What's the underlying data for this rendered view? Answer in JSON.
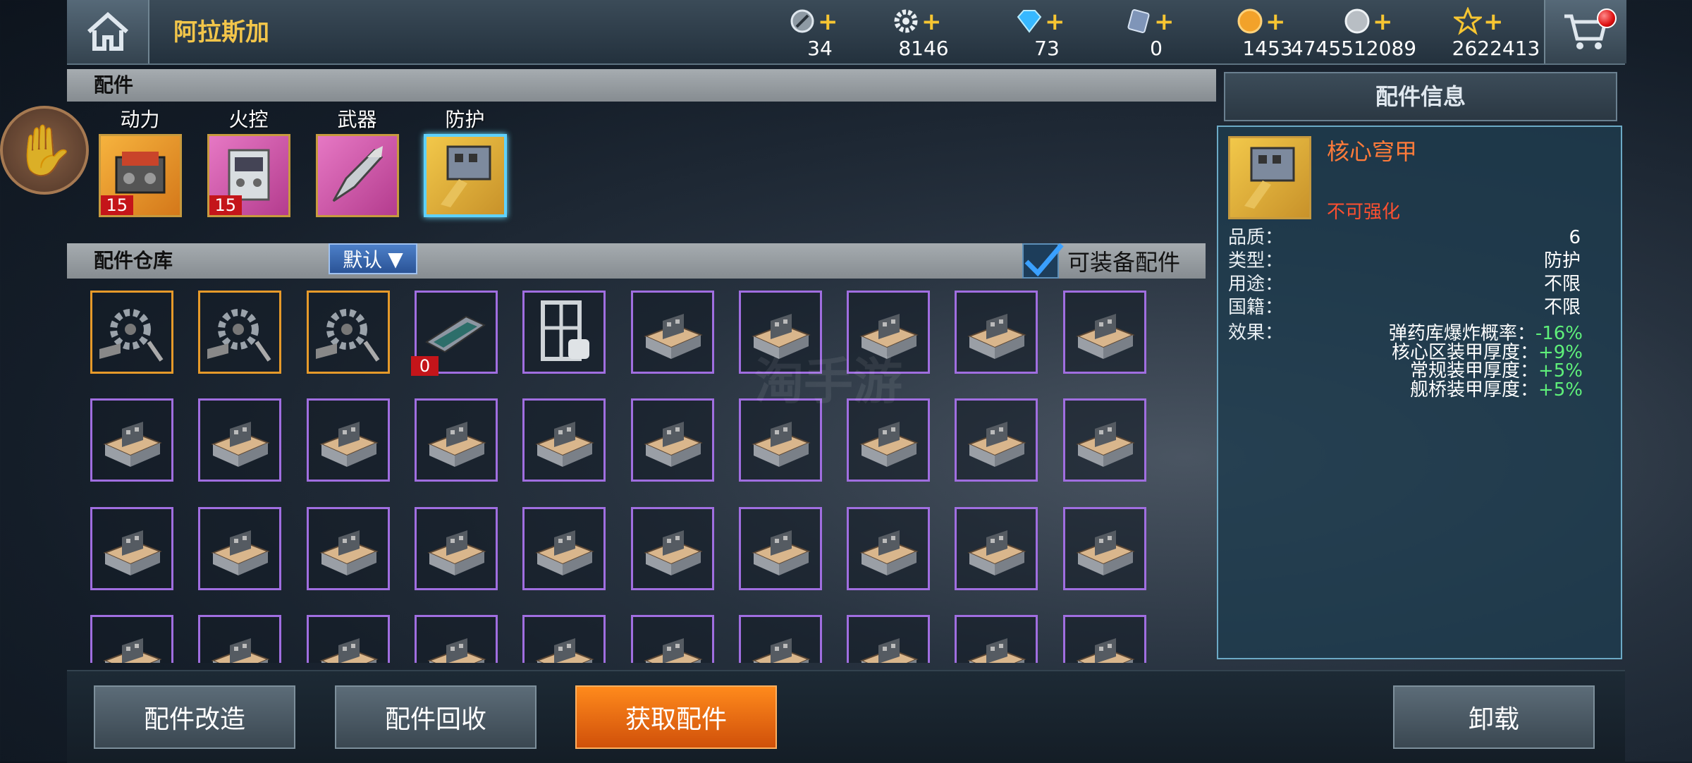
{
  "header": {
    "title": "阿拉斯加",
    "resources": [
      {
        "icon": "fuel-icon",
        "value": "34"
      },
      {
        "icon": "gear-parts-icon",
        "value": "8146"
      },
      {
        "icon": "diamond-icon",
        "value": "73"
      },
      {
        "icon": "ticket-icon",
        "value": "0"
      },
      {
        "icon": "gold-coin-icon",
        "value": "1453"
      },
      {
        "icon": "silver-coin-icon",
        "value": "4745512089"
      },
      {
        "icon": "star-icon",
        "value": "2622413"
      }
    ]
  },
  "parts_section": {
    "title": "配件",
    "categories": [
      {
        "label": "动力",
        "badge": "15"
      },
      {
        "label": "火控",
        "badge": "15"
      },
      {
        "label": "武器",
        "badge": ""
      },
      {
        "label": "防护",
        "badge": ""
      }
    ]
  },
  "storage": {
    "title": "配件仓库",
    "sort_label": "默认",
    "filter_label": "可装备配件",
    "special_badge": "0"
  },
  "info": {
    "header": "配件信息",
    "item_name": "核心穹甲",
    "enhance_status": "不可强化",
    "attributes": [
      {
        "key": "品质：",
        "value": "6"
      },
      {
        "key": "类型：",
        "value": "防护"
      },
      {
        "key": "用途：",
        "value": "不限"
      },
      {
        "key": "国籍：",
        "value": "不限"
      }
    ],
    "effect_label": "效果：",
    "effects": [
      {
        "key": "弹药库爆炸概率：",
        "value": "-16%"
      },
      {
        "key": "核心区装甲厚度：",
        "value": "+9%"
      },
      {
        "key": "常规装甲厚度：",
        "value": "+5%"
      },
      {
        "key": "舰桥装甲厚度：",
        "value": "+5%"
      }
    ]
  },
  "buttons": {
    "modify": "配件改造",
    "recycle": "配件回收",
    "obtain": "获取配件",
    "unload": "卸载"
  },
  "watermark": "淘手游",
  "colors": {
    "accent": "#f2c54a",
    "rare_border": "#a06ee0",
    "gold_border": "#e69a2a",
    "effect_green": "#5ff07a",
    "obtain_orange": "#ff8a1c"
  }
}
